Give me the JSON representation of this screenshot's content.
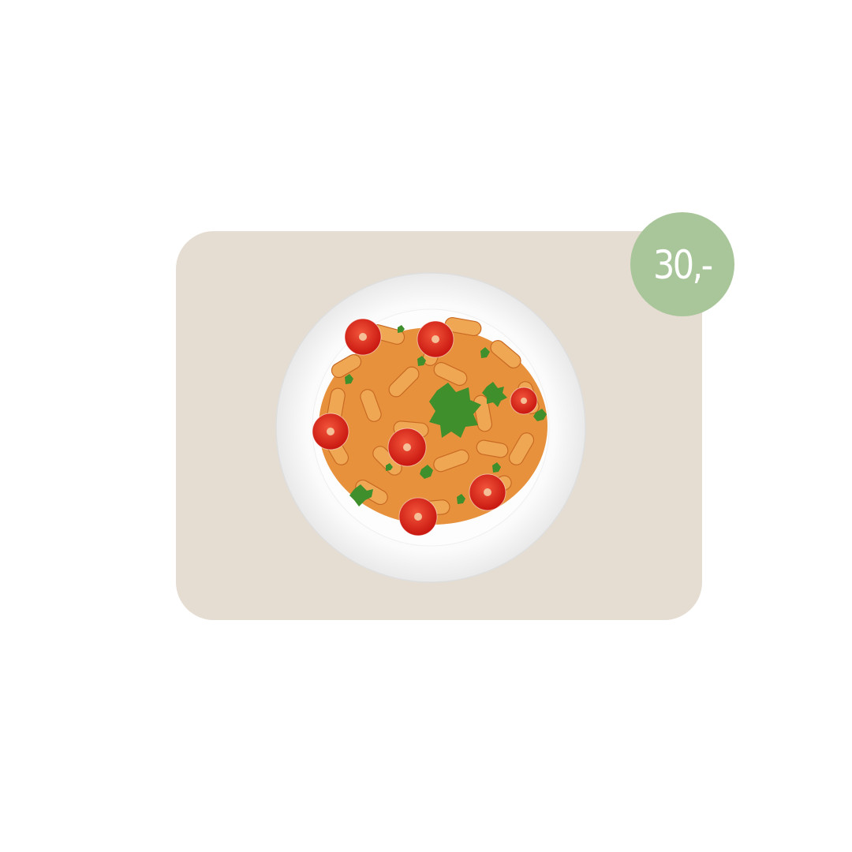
{
  "product": {
    "image_icon": "pasta-plate-icon",
    "price_label": "30,-"
  },
  "colors": {
    "background": "#ffffff",
    "card": "#e5ddd2",
    "badge": "#a9c69a",
    "badge_text": "#ffffff"
  }
}
